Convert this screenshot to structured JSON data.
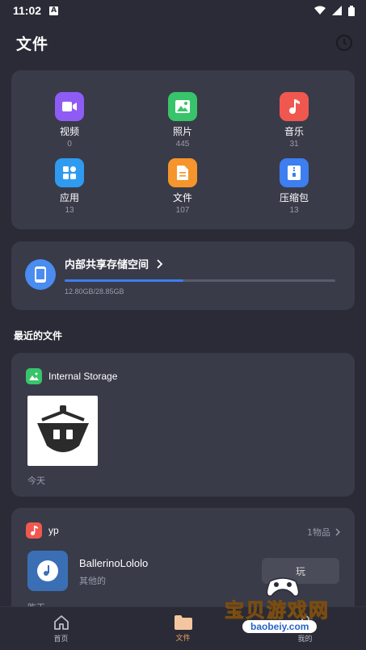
{
  "status": {
    "time": "11:02",
    "notification_icon": "A"
  },
  "header": {
    "title": "文件"
  },
  "categories": [
    {
      "label": "视频",
      "count": "0",
      "icon": "video-icon",
      "color": "#8e5cf5"
    },
    {
      "label": "照片",
      "count": "445",
      "icon": "photo-icon",
      "color": "#38c46a"
    },
    {
      "label": "音乐",
      "count": "31",
      "icon": "music-icon",
      "color": "#f0584f"
    },
    {
      "label": "应用",
      "count": "13",
      "icon": "apps-icon",
      "color": "#2f9bf0"
    },
    {
      "label": "文件",
      "count": "107",
      "icon": "document-icon",
      "color": "#f5952b"
    },
    {
      "label": "压缩包",
      "count": "13",
      "icon": "archive-icon",
      "color": "#3d7ef0"
    }
  ],
  "storage": {
    "title": "内部共享存储空间",
    "used": "12.80GB/28.85GB",
    "used_fraction": 0.44
  },
  "recent": {
    "section_title": "最近的文件",
    "group": {
      "name": "Internal Storage",
      "date": "今天"
    }
  },
  "app_group": {
    "name": "yp",
    "count": "1物品",
    "app_name": "BallerinoLololo",
    "app_sub": "其他的",
    "action": "玩",
    "date": "昨天"
  },
  "nav": [
    {
      "label": "首页",
      "icon": "home-icon"
    },
    {
      "label": "文件",
      "icon": "folder-icon"
    },
    {
      "label": "我的",
      "icon": "profile-icon"
    }
  ],
  "watermark": {
    "text": "宝贝游戏网",
    "url": "baobeiy.com"
  }
}
